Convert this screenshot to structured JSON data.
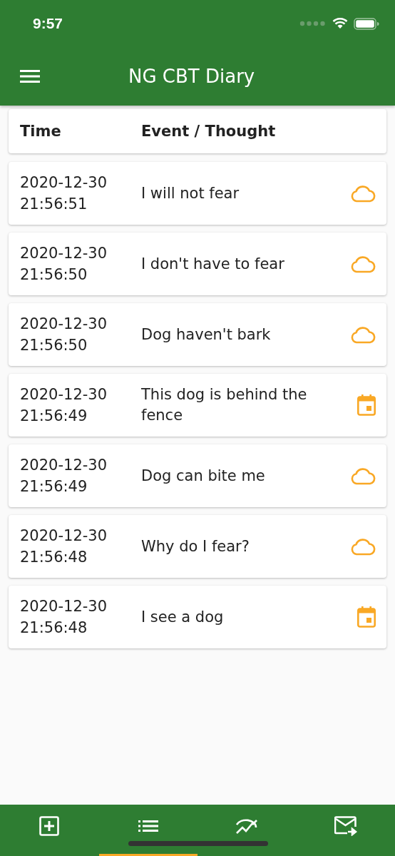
{
  "status_bar": {
    "time": "9:57"
  },
  "app_bar": {
    "title": "NG CBT Diary"
  },
  "table": {
    "columns": [
      "Time",
      "Event / Thought"
    ],
    "rows": [
      {
        "date": "2020-12-30",
        "time": "21:56:51",
        "text": "I will not fear",
        "kind": "thought"
      },
      {
        "date": "2020-12-30",
        "time": "21:56:50",
        "text": "I don't have to fear",
        "kind": "thought"
      },
      {
        "date": "2020-12-30",
        "time": "21:56:50",
        "text": "Dog haven't bark",
        "kind": "thought"
      },
      {
        "date": "2020-12-30",
        "time": "21:56:49",
        "text": "This dog is behind the fence",
        "kind": "event"
      },
      {
        "date": "2020-12-30",
        "time": "21:56:49",
        "text": "Dog can bite me",
        "kind": "thought"
      },
      {
        "date": "2020-12-30",
        "time": "21:56:48",
        "text": "Why do I fear?",
        "kind": "thought"
      },
      {
        "date": "2020-12-30",
        "time": "21:56:48",
        "text": "I see a dog",
        "kind": "event"
      }
    ]
  },
  "bottom_nav": [
    {
      "kind": "add",
      "selected": false
    },
    {
      "kind": "list",
      "selected": true
    },
    {
      "kind": "chart",
      "selected": false
    },
    {
      "kind": "mail",
      "selected": false
    }
  ]
}
